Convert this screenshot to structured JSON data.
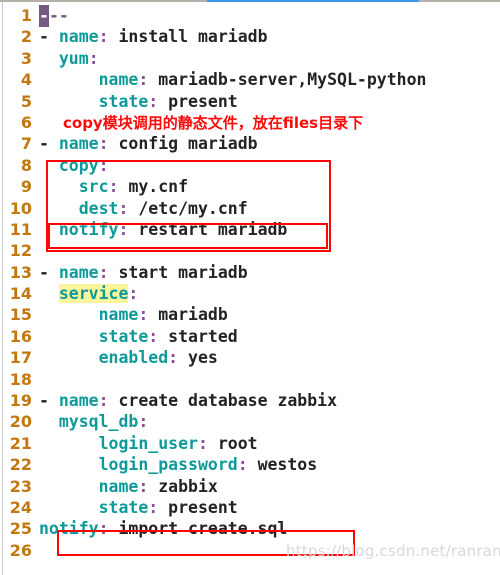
{
  "window": {
    "accent_color": "#3f94e8",
    "rule_color": "#b5b0aa"
  },
  "editor": {
    "background": "#ffffff",
    "line_number_color": "#c2780f",
    "key_color": "#0f9a9a",
    "colon_color": "#8b4f9e",
    "value_color": "#232323",
    "cursor_color": "#745a84",
    "highlight_color": "#faf49a",
    "annotation_color": "#ff0a0a",
    "total_lines": 26
  },
  "lines": [
    {
      "no": "1",
      "indent": "",
      "dash": "",
      "key": "",
      "value": "",
      "type": "cursor",
      "cursor_char": "-",
      "after_cursor": "--"
    },
    {
      "no": "2",
      "indent": "",
      "dash": "- ",
      "key": "name",
      "value": "install mariadb",
      "type": "kv"
    },
    {
      "no": "3",
      "indent": "  ",
      "dash": "",
      "key": "yum",
      "value": "",
      "type": "kv"
    },
    {
      "no": "4",
      "indent": "      ",
      "dash": "",
      "key": "name",
      "value": "mariadb-server,MySQL-python",
      "type": "kv"
    },
    {
      "no": "5",
      "indent": "      ",
      "dash": "",
      "key": "state",
      "value": "present",
      "type": "kv"
    },
    {
      "no": "6",
      "indent": "",
      "dash": "",
      "key": "",
      "value": "",
      "type": "note",
      "note": "copy模块调用的静态文件，放在files目录下"
    },
    {
      "no": "7",
      "indent": "",
      "dash": "- ",
      "key": "name",
      "value": "config mariadb",
      "type": "kv"
    },
    {
      "no": "8",
      "indent": "  ",
      "dash": "",
      "key": "copy",
      "value": "",
      "type": "kv"
    },
    {
      "no": "9",
      "indent": "    ",
      "dash": "",
      "key": "src",
      "value": "my.cnf",
      "type": "kv"
    },
    {
      "no": "10",
      "indent": "    ",
      "dash": "",
      "key": "dest",
      "value": "/etc/my.cnf",
      "type": "kv"
    },
    {
      "no": "11",
      "indent": "  ",
      "dash": "",
      "key": "notify",
      "value": "restart mariadb",
      "type": "kv"
    },
    {
      "no": "12",
      "indent": "",
      "dash": "",
      "key": "",
      "value": "",
      "type": "blank"
    },
    {
      "no": "13",
      "indent": "",
      "dash": "- ",
      "key": "name",
      "value": "start mariadb",
      "type": "kv"
    },
    {
      "no": "14",
      "indent": "  ",
      "dash": "",
      "key": "service",
      "value": "",
      "type": "kv",
      "key_highlight": true
    },
    {
      "no": "15",
      "indent": "      ",
      "dash": "",
      "key": "name",
      "value": "mariadb",
      "type": "kv"
    },
    {
      "no": "16",
      "indent": "      ",
      "dash": "",
      "key": "state",
      "value": "started",
      "type": "kv"
    },
    {
      "no": "17",
      "indent": "      ",
      "dash": "",
      "key": "enabled",
      "value": "yes",
      "type": "kv"
    },
    {
      "no": "18",
      "indent": "",
      "dash": "",
      "key": "",
      "value": "",
      "type": "blank"
    },
    {
      "no": "19",
      "indent": "",
      "dash": "- ",
      "key": "name",
      "value": "create database zabbix",
      "type": "kv"
    },
    {
      "no": "20",
      "indent": "  ",
      "dash": "",
      "key": "mysql_db",
      "value": "",
      "type": "kv"
    },
    {
      "no": "21",
      "indent": "      ",
      "dash": "",
      "key": "login_user",
      "value": "root",
      "type": "kv"
    },
    {
      "no": "22",
      "indent": "      ",
      "dash": "",
      "key": "login_password",
      "value": "westos",
      "type": "kv"
    },
    {
      "no": "23",
      "indent": "      ",
      "dash": "",
      "key": "name",
      "value": "zabbix",
      "type": "kv"
    },
    {
      "no": "24",
      "indent": "      ",
      "dash": "",
      "key": "state",
      "value": "present",
      "type": "kv"
    },
    {
      "no": "25",
      "indent": "",
      "dash": "",
      "key": "notify",
      "value": "import create.sql",
      "type": "kv"
    },
    {
      "no": "26",
      "indent": "",
      "dash": "",
      "key": "",
      "value": "",
      "type": "blank"
    }
  ],
  "annotations": {
    "boxes": [
      {
        "name": "copy-block-box",
        "color": "#fc0505"
      },
      {
        "name": "notify-restart-box",
        "color": "#fc0505"
      },
      {
        "name": "notify-import-box",
        "color": "#fc0505"
      }
    ]
  },
  "watermark": {
    "text": "https://blog.csdn.net/ranrancc_"
  }
}
